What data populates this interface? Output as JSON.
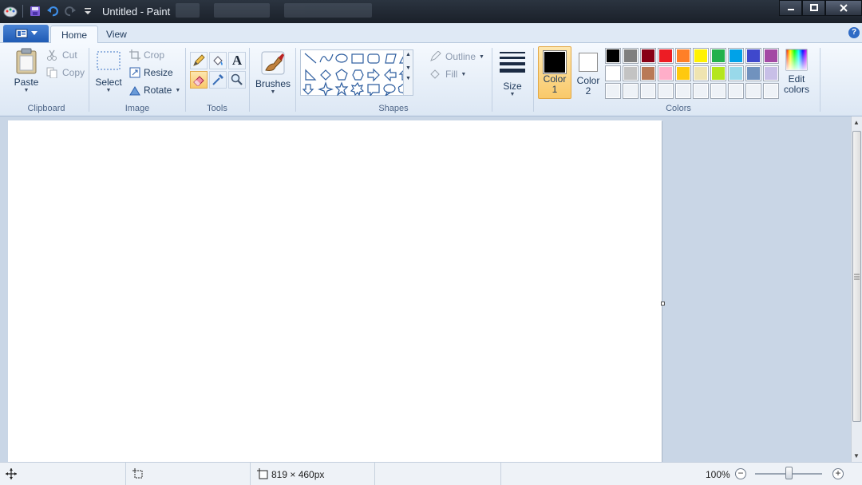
{
  "window": {
    "title": "Untitled - Paint",
    "controls": {
      "minimize": "minimize",
      "maximize": "maximize",
      "close": "close"
    }
  },
  "ribbon_tabs": [
    {
      "label": "Home",
      "active": true
    },
    {
      "label": "View",
      "active": false
    }
  ],
  "clipboard": {
    "paste": "Paste",
    "cut": "Cut",
    "copy": "Copy",
    "group": "Clipboard"
  },
  "image": {
    "select": "Select",
    "crop": "Crop",
    "resize": "Resize",
    "rotate": "Rotate",
    "group": "Image"
  },
  "tools": {
    "group": "Tools",
    "text_icon": "A"
  },
  "brushes": {
    "label": "Brushes"
  },
  "shapes": {
    "outline": "Outline",
    "fill": "Fill",
    "group": "Shapes"
  },
  "size": {
    "label": "Size"
  },
  "colors": {
    "color1_label": "Color",
    "color1_num": "1",
    "color2_label": "Color",
    "color2_num": "2",
    "color1_value": "#000000",
    "color2_value": "#ffffff",
    "edit_label": "Edit",
    "edit_label2": "colors",
    "group": "Colors",
    "palette_row1": [
      "#000000",
      "#7f7f7f",
      "#880015",
      "#ed1c24",
      "#ff7f27",
      "#fff200",
      "#22b14c",
      "#00a2e8",
      "#3f48cc",
      "#a349a4"
    ],
    "palette_row2": [
      "#ffffff",
      "#c3c3c3",
      "#b97a57",
      "#ffaec9",
      "#ffc90e",
      "#efe4b0",
      "#b5e61d",
      "#99d9ea",
      "#7092be",
      "#c8bfe7"
    ],
    "palette_row3": [
      "#eef2f7",
      "#eef2f7",
      "#eef2f7",
      "#eef2f7",
      "#eef2f7",
      "#eef2f7",
      "#eef2f7",
      "#eef2f7",
      "#eef2f7",
      "#eef2f7"
    ]
  },
  "status": {
    "canvas_size": "819 × 460px",
    "zoom": "100%",
    "zoom_level": 1.0
  }
}
